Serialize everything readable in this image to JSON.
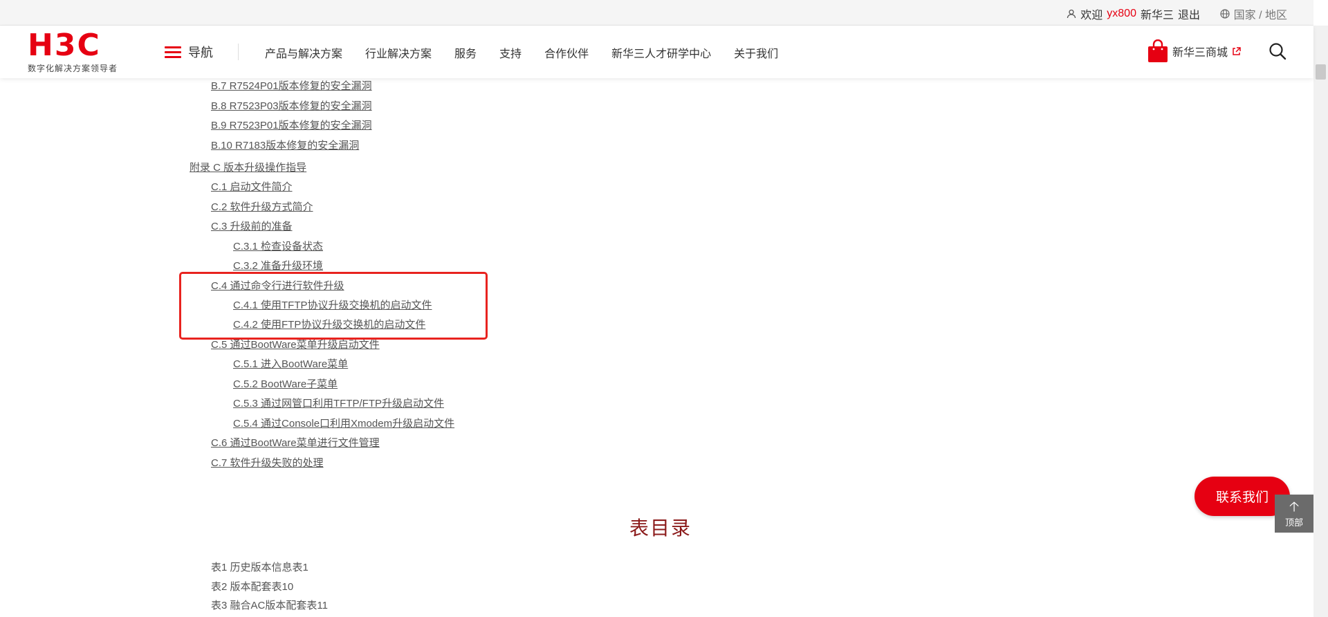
{
  "topbar": {
    "welcome": "欢迎",
    "username": "yx800",
    "company": "新华三",
    "logout": "退出",
    "region": "国家 / 地区"
  },
  "header": {
    "logo_mark": "H3C",
    "logo_tagline": "数字化解决方案领导者",
    "nav_label": "导航",
    "menu": [
      "产品与解决方案",
      "行业解决方案",
      "服务",
      "支持",
      "合作伙伴",
      "新华三人才研学中心",
      "关于我们"
    ],
    "shop_label": "新华三商城"
  },
  "toc": [
    "B.7 R7524P01版本修复的安全漏洞",
    "B.8 R7523P03版本修复的安全漏洞",
    "B.9 R7523P01版本修复的安全漏洞",
    "B.10 R7183版本修复的安全漏洞",
    "附录 C  版本升级操作指导",
    "C.1  启动文件简介",
    "C.2  软件升级方式简介",
    "C.3  升级前的准备",
    "C.3.1  检查设备状态",
    "C.3.2  准备升级环境",
    "C.4  通过命令行进行软件升级",
    "C.4.1  使用TFTP协议升级交换机的启动文件",
    "C.4.2  使用FTP协议升级交换机的启动文件",
    "C.5  通过BootWare菜单升级启动文件",
    "C.5.1  进入BootWare菜单",
    "C.5.2 BootWare子菜单",
    "C.5.3  通过网管口利用TFTP/FTP升级启动文件",
    "C.5.4  通过Console口利用Xmodem升级启动文件",
    "C.6  通过BootWare菜单进行文件管理",
    "C.7  软件升级失败的处理"
  ],
  "tables_title": "表目录",
  "tables": [
    "表1 历史版本信息表1",
    "表2 版本配套表10",
    "表3 融合AC版本配套表11"
  ],
  "float": {
    "contact": "联系我们",
    "top": "顶部"
  },
  "colors": {
    "brand": "#e60012",
    "highlight_box": "#e8231f",
    "section_title": "#8b1a1a"
  }
}
